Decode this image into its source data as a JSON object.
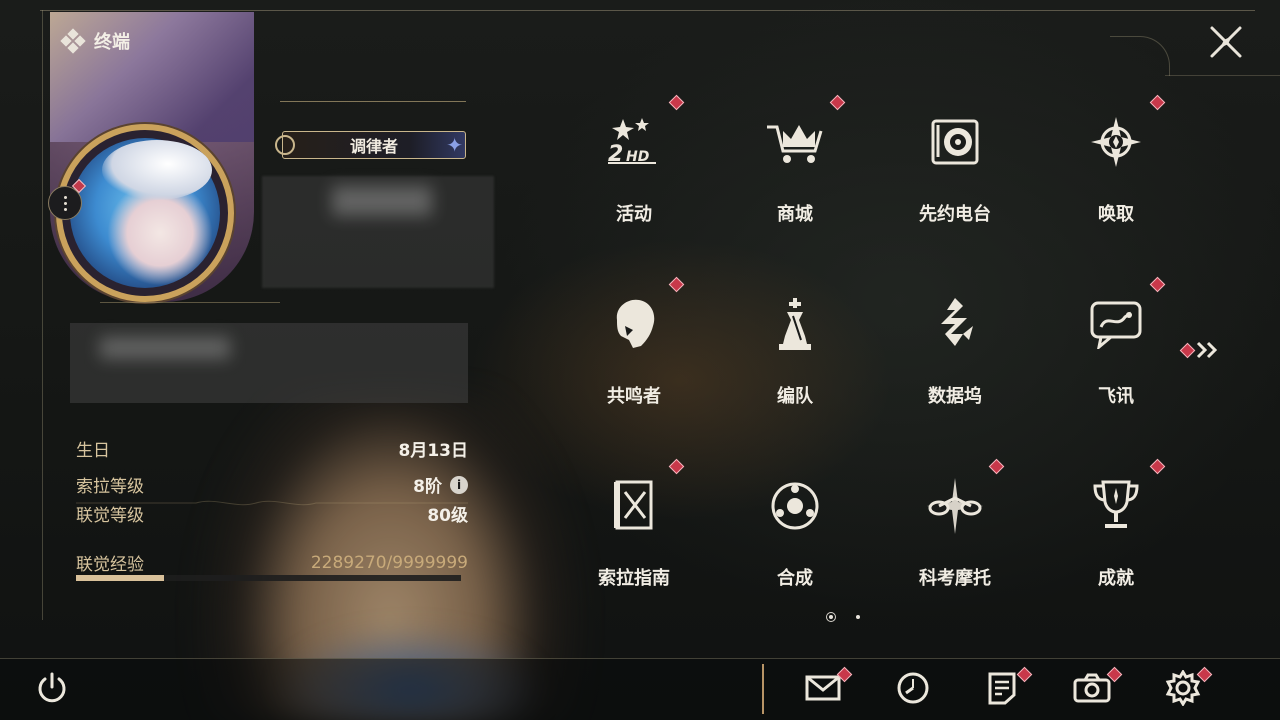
{
  "terminal": {
    "title": "终端"
  },
  "profile": {
    "title_badge": "调律者",
    "stats": [
      {
        "label": "生日",
        "value": "8月13日"
      },
      {
        "label": "索拉等级",
        "value": "8阶",
        "info": "i"
      },
      {
        "label": "联觉等级",
        "value": "80级"
      }
    ],
    "experience": {
      "label": "联觉经验",
      "value": "2289270/9999999",
      "progress": 0.229
    }
  },
  "menu": {
    "rows": [
      [
        {
          "label": "活动",
          "icon": "event-2hd-icon",
          "badge": true
        },
        {
          "label": "商城",
          "icon": "shop-cart-icon",
          "badge": true
        },
        {
          "label": "先约电台",
          "icon": "radio-record-icon",
          "badge": false
        },
        {
          "label": "唤取",
          "icon": "summon-compass-icon",
          "badge": true
        }
      ],
      [
        {
          "label": "共鸣者",
          "icon": "resonator-portrait-icon",
          "badge": true
        },
        {
          "label": "编队",
          "icon": "team-chess-icon",
          "badge": false
        },
        {
          "label": "数据坞",
          "icon": "data-bank-icon",
          "badge": false
        },
        {
          "label": "飞讯",
          "icon": "chat-message-icon",
          "badge": true
        }
      ],
      [
        {
          "label": "索拉指南",
          "icon": "guide-book-icon",
          "badge": true
        },
        {
          "label": "合成",
          "icon": "synthesis-orb-icon",
          "badge": false
        },
        {
          "label": "科考摩托",
          "icon": "motorcycle-icon",
          "badge": true
        },
        {
          "label": "成就",
          "icon": "trophy-icon",
          "badge": true
        }
      ]
    ],
    "pages": {
      "current": 1,
      "total": 2
    }
  },
  "bottom_bar": {
    "icons": [
      "power-icon",
      "mail-icon",
      "clock-icon",
      "notice-icon",
      "camera-icon",
      "settings-gear-icon"
    ]
  },
  "colors": {
    "accent_gold": "#c9b68c",
    "badge_red": "#c8384a",
    "text_light": "#f1ede4",
    "label_tan": "#d7c49e"
  }
}
